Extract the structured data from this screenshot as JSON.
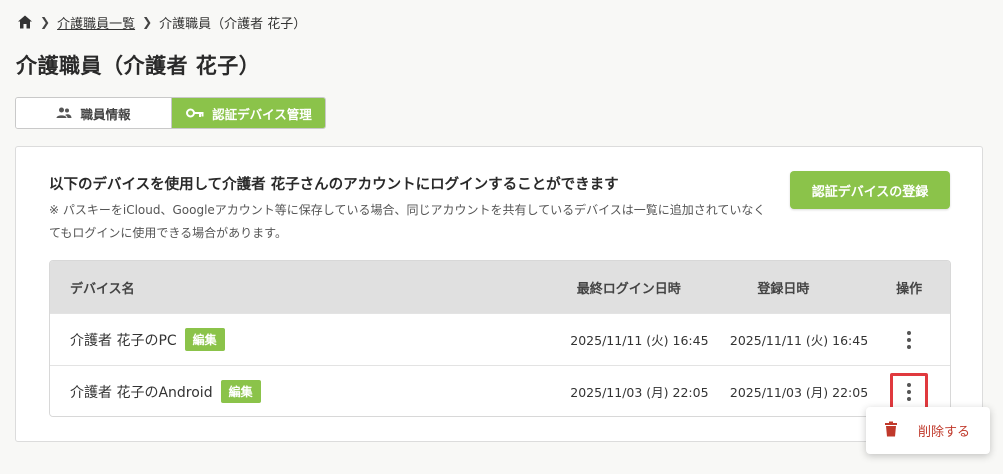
{
  "breadcrumb": {
    "list": "介護職員一覧",
    "current": "介護職員（介護者 花子）"
  },
  "page": {
    "title": "介護職員（介護者 花子）"
  },
  "tabs": [
    {
      "label": "職員情報",
      "icon": "people-icon",
      "active": false
    },
    {
      "label": "認証デバイス管理",
      "icon": "key-icon",
      "active": true
    }
  ],
  "card": {
    "title": "以下のデバイスを使用して介護者 花子さんのアカウントにログインすることができます",
    "note": "※ パスキーをiCloud、Googleアカウント等に保存している場合、同じアカウントを共有しているデバイスは一覧に追加されていなくてもログインに使用できる場合があります。",
    "register_label": "認証デバイスの登録"
  },
  "table": {
    "headers": {
      "name": "デバイス名",
      "last_login": "最終ログイン日時",
      "registered": "登録日時",
      "actions": "操作"
    },
    "rows": [
      {
        "name": "介護者 花子のPC",
        "edit": "編集",
        "last_login": "2025/11/11 (火) 16:45",
        "registered": "2025/11/11 (火) 16:45"
      },
      {
        "name": "介護者 花子のAndroid",
        "edit": "編集",
        "last_login": "2025/11/03 (月) 22:05",
        "registered": "2025/11/03 (月) 22:05"
      }
    ]
  },
  "menu": {
    "delete_label": "削除する"
  },
  "colors": {
    "accent": "#8bc34a",
    "danger": "#c0392b",
    "highlight": "#e0393e"
  }
}
